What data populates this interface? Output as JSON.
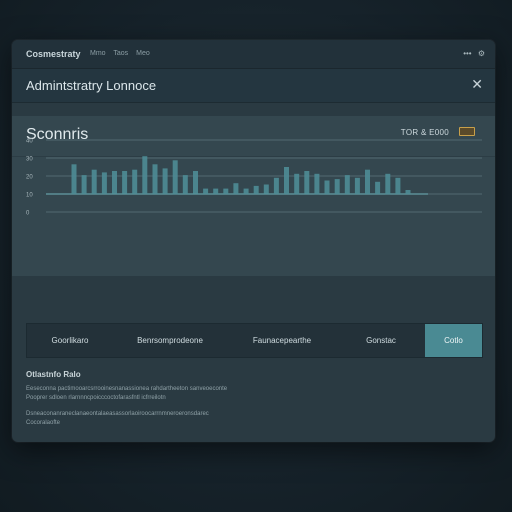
{
  "window": {
    "app_title": "Cosmestraty",
    "breadcrumbs": [
      "Mmo",
      "Taos",
      "Meo"
    ],
    "controls": [
      "•••",
      "⚙"
    ]
  },
  "dialog": {
    "title": "Admintstratry Lonnoce",
    "close_label": "✕"
  },
  "panel": {
    "title": "Sconnris",
    "meta": "TOR & E000"
  },
  "chart_data": {
    "type": "bar",
    "y_tick_labels": [
      "40",
      "30",
      "20",
      "10",
      "0"
    ],
    "ylim": [
      0,
      40
    ],
    "grid": true,
    "series": [
      {
        "values": [
          22,
          14,
          18,
          16,
          17,
          17,
          18,
          28,
          22,
          19,
          25,
          14,
          17,
          4,
          4,
          4,
          8,
          4,
          6,
          7,
          12,
          20,
          15,
          17,
          15,
          10,
          11,
          14,
          12,
          18,
          9,
          15,
          12,
          3
        ]
      }
    ]
  },
  "tabs": [
    {
      "label": "Goorlikaro",
      "active": false
    },
    {
      "label": "Benrsomprodeone",
      "active": false
    },
    {
      "label": "Faunacepearthe",
      "active": false
    },
    {
      "label": "Gonstac",
      "active": false
    },
    {
      "label": "Cotlo",
      "active": true
    }
  ],
  "info": {
    "title": "Otlastnfo Ralo",
    "lines": [
      "Eeseconna pactimooarcsrrooinesnanassionea rahdartheeton sanveoeconte",
      "Pooprer sdloen rlarnnncpoicccoctofarasfntl icfrreilotn",
      "Dsneaconanraneclanaeontalaeasassorlaoiroocarrnmneroeronsdarec",
      "Cocoralaofte"
    ]
  },
  "colors": {
    "accent": "#4a8a93",
    "bar": "#4e8c95",
    "badge": "#c8a04a"
  }
}
